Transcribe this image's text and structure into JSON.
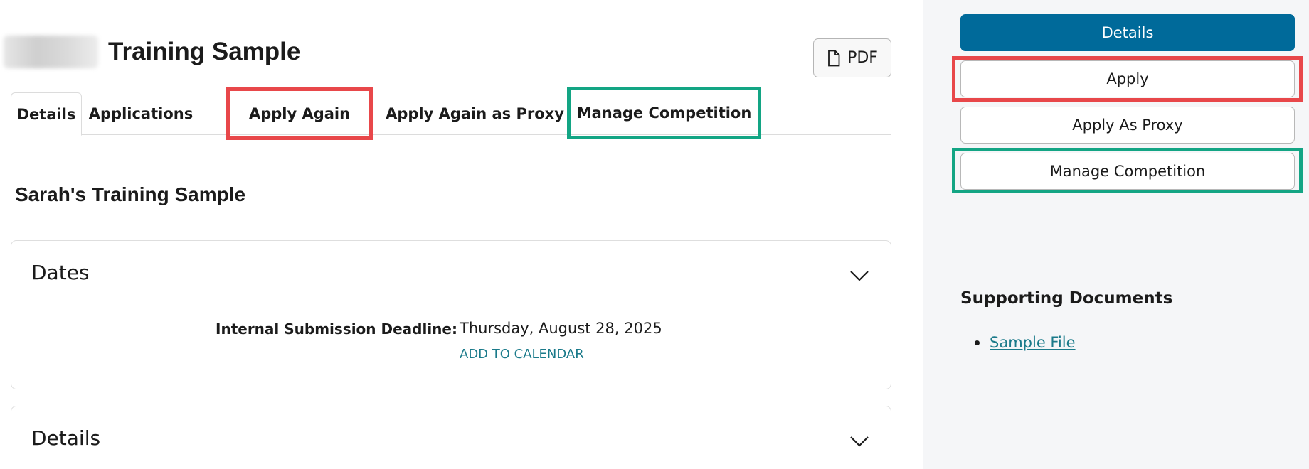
{
  "header": {
    "title": "Training Sample",
    "pdf_label": "PDF",
    "pdf_icon": "file-icon"
  },
  "tabs": [
    {
      "label": "Details",
      "active": true
    },
    {
      "label": "Applications",
      "active": false
    },
    {
      "label": "Apply Again",
      "active": false,
      "highlight": "red"
    },
    {
      "label": "Apply Again as Proxy",
      "active": false
    },
    {
      "label": "Manage Competition",
      "active": false,
      "highlight": "green"
    }
  ],
  "content": {
    "heading": "Sarah's Training Sample",
    "dates_card": {
      "title": "Dates",
      "deadline_label": "Internal Submission Deadline:",
      "deadline_value": "Thursday, August 28, 2025",
      "calendar_link": "ADD TO CALENDAR"
    },
    "details_card": {
      "title": "Details"
    }
  },
  "sidebar": {
    "buttons": [
      {
        "label": "Details",
        "style": "primary"
      },
      {
        "label": "Apply",
        "style": "secondary",
        "highlight": "red"
      },
      {
        "label": "Apply As Proxy",
        "style": "secondary"
      },
      {
        "label": "Manage Competition",
        "style": "secondary",
        "highlight": "green"
      }
    ],
    "documents_heading": "Supporting Documents",
    "documents": [
      {
        "label": "Sample File"
      }
    ]
  },
  "colors": {
    "primary": "#006a9a",
    "link": "#1a7a8a",
    "highlight_red": "#e8474a",
    "highlight_green": "#13a584",
    "sidebar_bg": "#f5f6f8"
  }
}
